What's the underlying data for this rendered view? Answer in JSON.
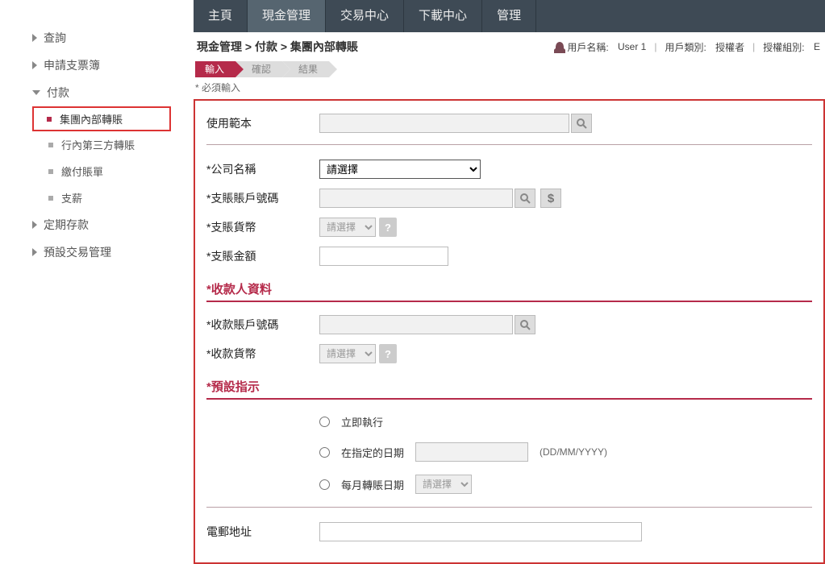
{
  "topnav": {
    "items": [
      "主頁",
      "現金管理",
      "交易中心",
      "下載中心",
      "管理"
    ],
    "active_index": 1
  },
  "sidebar": {
    "items": [
      {
        "label": "查詢",
        "level": 1,
        "expanded": false
      },
      {
        "label": "申請支票簿",
        "level": 1,
        "expanded": false
      },
      {
        "label": "付款",
        "level": 1,
        "expanded": true
      },
      {
        "label": "集團內部轉賬",
        "level": 2,
        "active": true
      },
      {
        "label": "行內第三方轉賬",
        "level": 2
      },
      {
        "label": "繳付賬單",
        "level": 2
      },
      {
        "label": "支薪",
        "level": 2
      },
      {
        "label": "定期存款",
        "level": 1,
        "expanded": false
      },
      {
        "label": "預設交易管理",
        "level": 1,
        "expanded": false
      }
    ]
  },
  "breadcrumb": "現金管理 > 付款 > 集團內部轉賬",
  "user": {
    "name_label": "用戶名稱:",
    "name": "User 1",
    "type_label": "用戶類別:",
    "type": "授權者",
    "group_label": "授權組別:",
    "group": "E"
  },
  "steps": {
    "items": [
      "輸入",
      "確認",
      "結果"
    ],
    "active_index": 0
  },
  "required_note": "* 必須輸入",
  "form": {
    "template_label": "使用範本",
    "company_label": "*公司名稱",
    "company_placeholder": "請選擇",
    "debit_acct_label": "*支賬賬戶號碼",
    "debit_ccy_label": "*支賬貨幣",
    "debit_ccy_placeholder": "請選擇",
    "debit_amt_label": "*支賬金額",
    "payee_section": "*收款人資料",
    "credit_acct_label": "*收款賬戶號碼",
    "credit_ccy_label": "*收款貨幣",
    "credit_ccy_placeholder": "請選擇",
    "schedule_section": "*預設指示",
    "radio_now": "立即執行",
    "radio_date": "在指定的日期",
    "date_hint": "(DD/MM/YYYY)",
    "radio_monthly": "每月轉賬日期",
    "monthly_placeholder": "請選擇",
    "email_label": "電郵地址"
  }
}
